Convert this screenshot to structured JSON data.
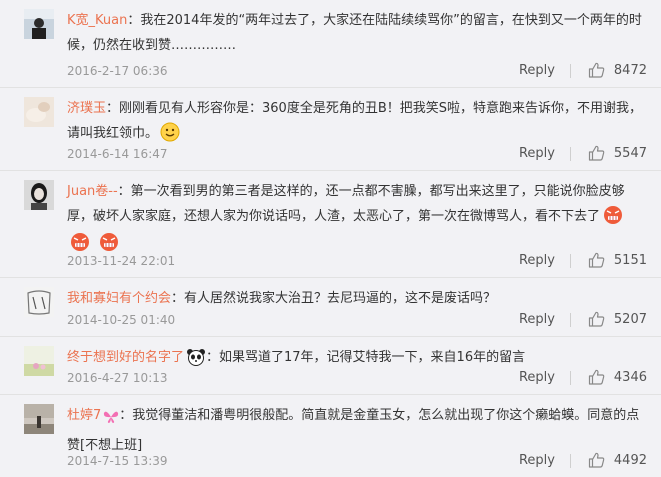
{
  "comments": [
    {
      "user": "K宽_Kuan",
      "text": "：我在2014年发的“两年过去了，大家还在陆陆续续骂你”的留言，在快到又一个两年的时候，仍然在收到赞……………",
      "time": "2016-2-17 06:36",
      "reply": "Reply",
      "likes": "8472"
    },
    {
      "user": "济璞玉",
      "text": "：刚刚看见有人形容你是：360度全是死角的丑B！把我笑S啦，特意跑来告诉你，不用谢我，请叫我红领巾。",
      "emoji": "smile-emoji",
      "time": "2014-6-14 16:47",
      "reply": "Reply",
      "likes": "5547"
    },
    {
      "user": "Juan卷--",
      "text": "：第一次看到男的第三者是这样的，还一点都不害臊，都写出来这里了，只能说你脸皮够厚，破坏人家家庭，还想人家为你说话吗，人渣，太恶心了，第一次在微博骂人，看不下去了",
      "emoji": "angry-emoji",
      "time": "2013-11-24 22:01",
      "reply": "Reply",
      "likes": "5151"
    },
    {
      "user": "我和寡妇有个约会",
      "text": "：有人居然说我家大治丑？去尼玛逼的，这不是废话吗？",
      "time": "2014-10-25 01:40",
      "reply": "Reply",
      "likes": "5207"
    },
    {
      "user": "终于想到好的名字了",
      "text": "：如果骂道了17年，记得艾特我一下，来自16年的留言",
      "badge": "panda-emoji",
      "time": "2016-4-27 10:13",
      "reply": "Reply",
      "likes": "4346"
    },
    {
      "user": "杜婷7",
      "text": "：我觉得董洁和潘粤明很般配。简直就是金童玉女，怎么就出现了你这个癞蛤蟆。同意的点赞[不想上班]",
      "badge": "butterfly-icon",
      "time": "2014-7-15 13:39",
      "reply": "Reply",
      "likes": "4492"
    }
  ]
}
